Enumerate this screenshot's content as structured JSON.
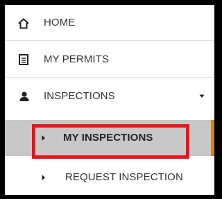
{
  "nav": {
    "items": [
      {
        "label": "HOME",
        "icon": "home-icon"
      },
      {
        "label": "MY PERMITS",
        "icon": "document-icon"
      },
      {
        "label": "INSPECTIONS",
        "icon": "user-icon",
        "expanded": true
      }
    ],
    "sub_items": [
      {
        "label": "MY INSPECTIONS",
        "active": true
      },
      {
        "label": "REQUEST INSPECTION",
        "active": false
      }
    ]
  },
  "colors": {
    "frame": "#000000",
    "active_bg": "#c8c8c8",
    "active_accent": "#c8852e",
    "highlight": "#e8161c",
    "text": "#333333"
  }
}
